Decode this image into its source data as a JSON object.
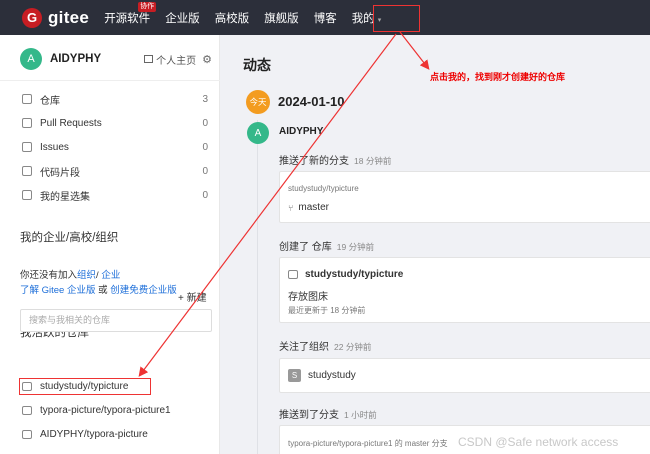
{
  "brand": {
    "logo_letter": "G",
    "name": "gitee"
  },
  "nav": {
    "items": [
      "开源软件",
      "企业版",
      "高校版",
      "旗舰版",
      "博客"
    ],
    "badge": "协作",
    "mine": "我的",
    "caret": "▾"
  },
  "sidebar": {
    "user": {
      "initial": "A",
      "name": "AIDYPHY",
      "homepage": "个人主页",
      "gear": "⚙"
    },
    "items": [
      {
        "icon": "repo-icon",
        "label": "仓库",
        "count": "3"
      },
      {
        "icon": "pull-request-icon",
        "label": "Pull Requests",
        "count": "0"
      },
      {
        "icon": "issues-icon",
        "label": "Issues",
        "count": "0"
      },
      {
        "icon": "code-icon",
        "label": "代码片段",
        "count": "0"
      },
      {
        "icon": "collection-icon",
        "label": "我的星选集",
        "count": "0"
      }
    ],
    "org_title": "我的企业/高校/组织",
    "org_line1_prefix": "你还没有加入",
    "org_link1": "组织",
    "org_sep": "/ ",
    "org_link2": "企业",
    "org_line2_link1": "了解 Gitee 企业版",
    "org_line2_mid": " 或 ",
    "org_line2_link2": "创建免费企业版",
    "repos_title": "我活跃的仓库",
    "new_label": "+ 新建",
    "search_placeholder": "搜索与我相关的仓库",
    "repos": [
      "studystudy/typicture",
      "typora-picture/typora-picture1",
      "AIDYPHY/typora-picture"
    ]
  },
  "main": {
    "title": "动态",
    "note": "点击我的，找到刚才创建好的仓库",
    "today": "今天",
    "date": "2024-01-10",
    "user_initial": "A",
    "user": "AIDYPHY",
    "events": [
      {
        "text": "推送了新的分支",
        "time": "18 分钟前"
      },
      {
        "text": "创建了 仓库",
        "time": "19 分钟前"
      },
      {
        "text": "关注了组织",
        "time": "22 分钟前"
      },
      {
        "text": "推送到了分支",
        "time": "1 小时前"
      }
    ],
    "card1": {
      "repo": "studystudy/typicture",
      "branch": "master",
      "branch_icon": "⑂"
    },
    "card2": {
      "repo": "studystudy/typicture",
      "desc": "存放图床",
      "updated": "最近更新于 18 分钟前"
    },
    "card3": {
      "org_initial": "S",
      "org": "studystudy"
    },
    "card4": {
      "text": "typora-picture/typora-picture1 的 master 分支"
    }
  },
  "watermark": "CSDN @Safe network access",
  "colors": {
    "brand_red": "#c71d23",
    "nav_bg": "#2c2f3a",
    "avatar_green": "#34b88a",
    "today_orange": "#f39c20",
    "annotation_red": "#e33",
    "link_blue": "#1e6fd9"
  }
}
